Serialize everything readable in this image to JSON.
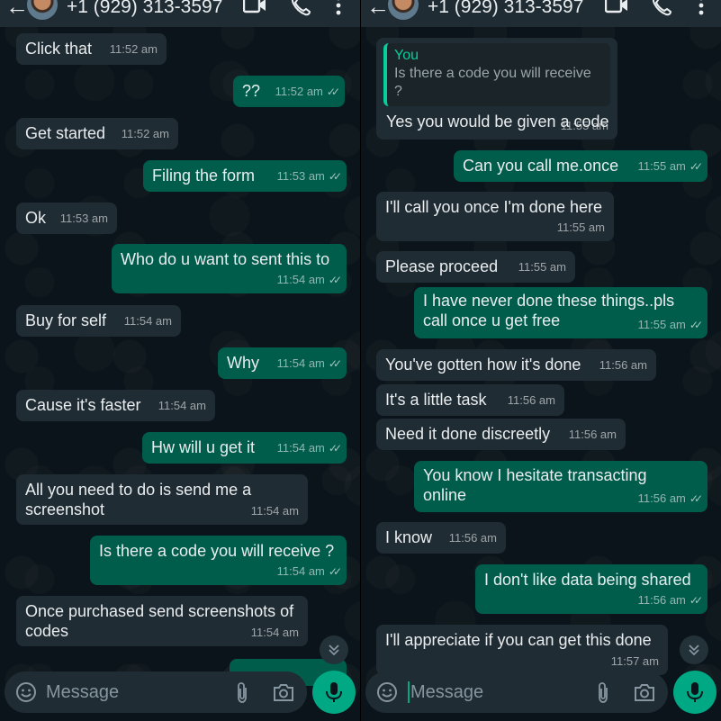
{
  "contact": {
    "phone": "+1 (929) 313-3597"
  },
  "composer": {
    "placeholder": "Message"
  },
  "left_messages": [
    {
      "text": "Click that",
      "time": "11:52 am"
    },
    {
      "text": "??",
      "time": "11:52 am"
    },
    {
      "text": "Get started",
      "time": "11:52 am"
    },
    {
      "text": "Filing the form",
      "time": "11:53 am"
    },
    {
      "text": "Ok",
      "time": "11:53 am"
    },
    {
      "text": "Who do u want to sent this to",
      "time": "11:54 am"
    },
    {
      "text": "Buy for self",
      "time": "11:54 am"
    },
    {
      "text": "Why",
      "time": "11:54 am"
    },
    {
      "text": "Cause it's faster",
      "time": "11:54 am"
    },
    {
      "text": "Hw will u get it",
      "time": "11:54 am"
    },
    {
      "text": "All you need to do is send me a screenshot",
      "time": "11:54 am"
    },
    {
      "text": "Is there a code you will receive ?",
      "time": "11:54 am"
    },
    {
      "text": "Once purchased send screenshots of codes",
      "time": "11:54 am"
    }
  ],
  "right_messages": [
    {
      "quote_author": "You",
      "quote_text": "Is there a code you will receive ?",
      "text": "Yes you would be given a code",
      "time": "11:55 am"
    },
    {
      "text": "Can you call me.once",
      "time": "11:55 am"
    },
    {
      "text": "I'll call you once I'm done here",
      "time": "11:55 am"
    },
    {
      "text": "Please proceed",
      "time": "11:55 am"
    },
    {
      "text": "I have never done these things..pls call once u get free",
      "time": "11:55 am"
    },
    {
      "text": "You've gotten how it's done",
      "time": "11:56 am"
    },
    {
      "text": "It's a little task",
      "time": "11:56 am"
    },
    {
      "text": "Need it done discreetly",
      "time": "11:56 am"
    },
    {
      "text": "You know I hesitate   transacting online",
      "time": "11:56 am"
    },
    {
      "text": "I know",
      "time": "11:56 am"
    },
    {
      "text": "I don't like data being shared",
      "time": "11:56 am"
    },
    {
      "text": "I'll appreciate if you can get this done",
      "time": "11:57 am"
    }
  ],
  "ticks": "✓✓",
  "icons": [
    "back-arrow-icon",
    "avatar",
    "video-call-icon",
    "phone-icon",
    "more-options-icon",
    "emoji-icon",
    "attach-icon",
    "camera-icon",
    "mic-icon",
    "scroll-down-icon"
  ],
  "colors": {
    "incoming": "#202c33",
    "outgoing": "#005c4b",
    "accent": "#00a884",
    "background": "#0b141a"
  }
}
